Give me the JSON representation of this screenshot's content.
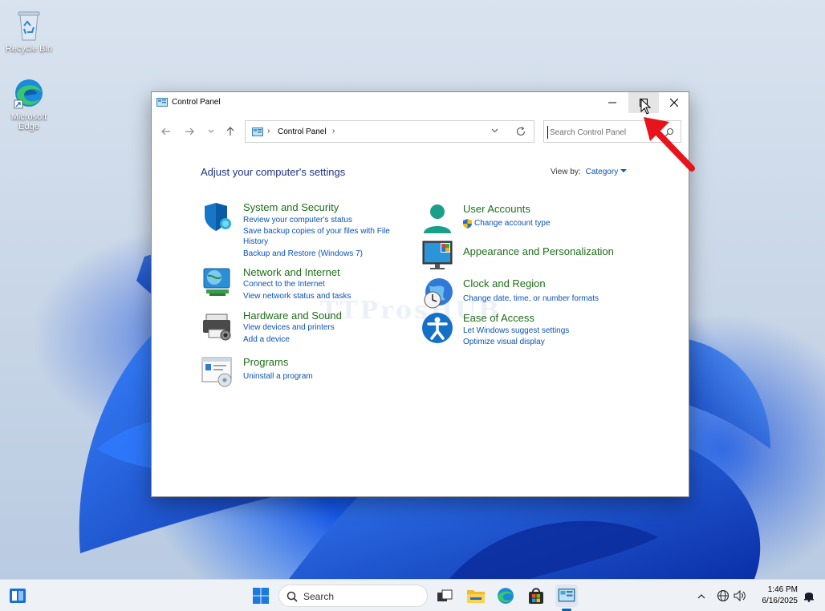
{
  "desktop": {
    "icons": [
      {
        "label": "Recycle Bin"
      },
      {
        "label": "Microsoft Edge"
      }
    ]
  },
  "window": {
    "title": "Control Panel",
    "address": {
      "crumb": "Control Panel"
    },
    "search": {
      "placeholder": "Search Control Panel"
    },
    "heading": "Adjust your computer's settings",
    "view_by": {
      "label": "View by:",
      "value": "Category"
    },
    "categories": [
      {
        "title": "System and Security",
        "links": [
          "Review your computer's status",
          "Save backup copies of your files with File",
          "History",
          "Backup and Restore (Windows 7)"
        ]
      },
      {
        "title": "Network and Internet",
        "links": [
          "Connect to the Internet",
          "View network status and tasks"
        ]
      },
      {
        "title": "Hardware and Sound",
        "links": [
          "View devices and printers",
          "Add a device"
        ]
      },
      {
        "title": "Programs",
        "links": [
          "Uninstall a program"
        ]
      },
      {
        "title": "User Accounts",
        "links": [
          "Change account type"
        ]
      },
      {
        "title": "Appearance and Personalization",
        "links": []
      },
      {
        "title": "Clock and Region",
        "links": [
          "Change date, time, or number formats"
        ]
      },
      {
        "title": "Ease of Access",
        "links": [
          "Let Windows suggest settings",
          "Optimize visual display"
        ]
      }
    ],
    "watermark": "TTProsHUB"
  },
  "taskbar": {
    "search_label": "Search",
    "time": "1:46 PM",
    "date": "6/16/2025"
  },
  "colors": {
    "category_title": "#1d6f18",
    "link": "#0a53b8",
    "heading": "#1e3287",
    "annotation_arrow": "#e8141b"
  }
}
